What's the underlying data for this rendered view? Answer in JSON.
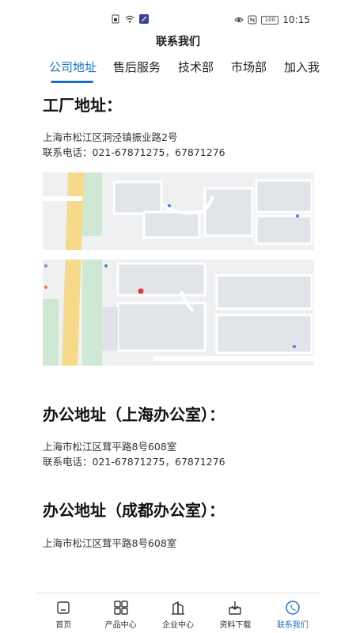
{
  "status_bar": {
    "time": "10:15",
    "battery": "100",
    "icons": [
      "sim-icon",
      "wifi-icon",
      "app-icon",
      "eye-icon",
      "nfc-icon",
      "battery-icon"
    ]
  },
  "header": {
    "title": "联系我们"
  },
  "tabs": [
    {
      "label": "公司地址",
      "active": true
    },
    {
      "label": "售后服务",
      "active": false
    },
    {
      "label": "技术部",
      "active": false
    },
    {
      "label": "市场部",
      "active": false
    },
    {
      "label": "加入我",
      "active": false
    }
  ],
  "colors": {
    "accent": "#1a73c9",
    "text": "#222222"
  },
  "sections": [
    {
      "title": "工厂地址：",
      "lines": [
        "上海市松江区洞泾镇振业路2号",
        "联系电话：021-67871275，67871276"
      ]
    },
    {
      "title": "办公地址（上海办公室）：",
      "lines": [
        "上海市松江区茸平路8号608室",
        "联系电话：021-67871275，67871276"
      ]
    },
    {
      "title": "办公地址（成都办公室）：",
      "lines": [
        "上海市松江区茸平路8号608室"
      ]
    }
  ],
  "bottom_nav": [
    {
      "label": "首页",
      "icon": "home-icon",
      "active": false
    },
    {
      "label": "产品中心",
      "icon": "grid-icon",
      "active": false
    },
    {
      "label": "企业中心",
      "icon": "building-icon",
      "active": false
    },
    {
      "label": "资料下载",
      "icon": "download-icon",
      "active": false
    },
    {
      "label": "联系我们",
      "icon": "phone-icon",
      "active": true
    }
  ]
}
